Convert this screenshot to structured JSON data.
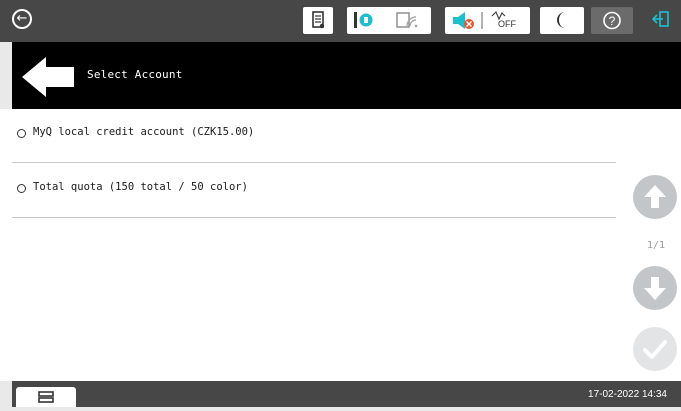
{
  "header": {
    "title": "Select Account"
  },
  "accounts": [
    {
      "label": "MyQ local credit account (CZK15.00)"
    },
    {
      "label": "Total quota (150 total / 50 color)"
    }
  ],
  "pager": {
    "indicator": "1/1"
  },
  "footer": {
    "datetime": "17-02-2022 14:34"
  },
  "status_icons": {
    "wifi_off_label": "OFF"
  },
  "colors": {
    "status_bar": "#474747",
    "header": "#000000",
    "accent": "#1bc0cf",
    "disabled_button": "#c3c6c9"
  }
}
